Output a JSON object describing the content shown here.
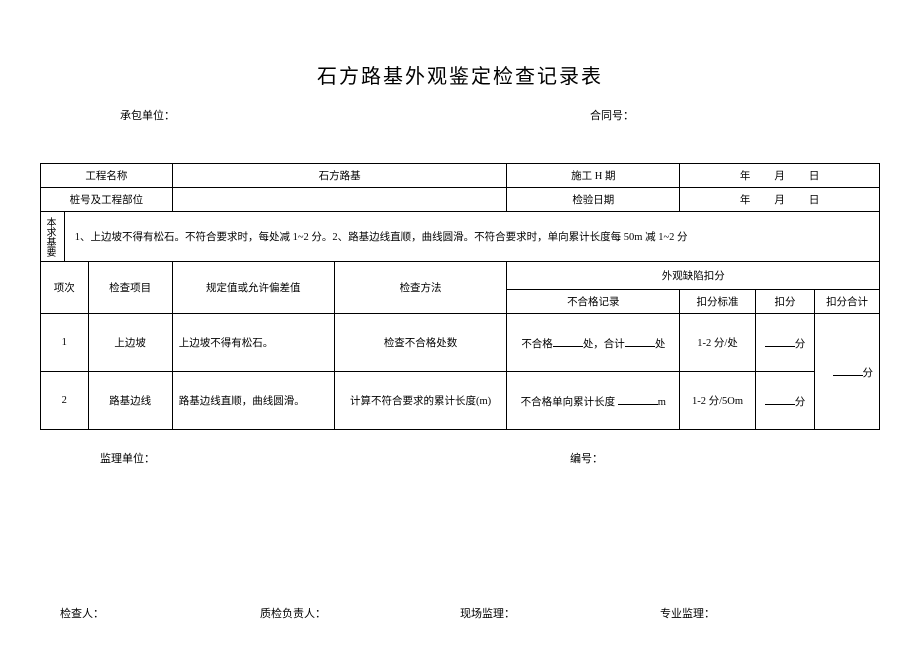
{
  "title": "石方路基外观鉴定检查记录表",
  "header": {
    "contractor_label": "承包单位：",
    "contract_no_label": "合同号："
  },
  "table": {
    "row1": {
      "project_name_label": "工程名称",
      "project_name_value": "石方路基",
      "construction_period_label": "施工 H 期",
      "date_y": "年",
      "date_m": "月",
      "date_d": "日"
    },
    "row2": {
      "station_label": "桩号及工程部位",
      "inspection_date_label": "检验日期",
      "date_y": "年",
      "date_m": "月",
      "date_d": "日"
    },
    "requirements": {
      "label": "本求基要",
      "text": "1、上边坡不得有松石。不符合要求时，每处减 1~2 分。2、路基边线直顺，曲线圆滑。不符合要求时，单向累计长度每 50m 减 1~2 分"
    },
    "header_row": {
      "item_no": "项次",
      "check_item": "检查项目",
      "spec_value": "规定值或允许偏差值",
      "check_method": "检查方法",
      "defect_group": "外观缺陷扣分",
      "noncon_record": "不合格记录",
      "deduct_std": "扣分标准",
      "deduct": "扣分",
      "deduct_total": "扣分合计"
    },
    "rows": [
      {
        "no": "1",
        "item": "上边坡",
        "spec": "上边坡不得有松石。",
        "method": "检查不合格处数",
        "record_prefix": "不合格",
        "record_mid": "处，合计",
        "record_suffix": "处",
        "std": "1-2 分/处",
        "deduct_suffix": "分",
        "total_suffix": "分"
      },
      {
        "no": "2",
        "item": "路基边线",
        "spec": "路基边线直顺，曲线圆滑。",
        "method": "计算不符合要求的累计长度(m)",
        "record_prefix": "不合格单向累计长度",
        "record_suffix": "m",
        "std": "1-2 分/5Om",
        "deduct_suffix": "分"
      }
    ]
  },
  "footer1": {
    "supervisor_unit": "监理单位：",
    "serial_no": "编号："
  },
  "footer2": {
    "inspector": "检查人：",
    "qc_manager": "质检负责人：",
    "site_supervisor": "现场监理：",
    "pro_supervisor": "专业监理："
  }
}
